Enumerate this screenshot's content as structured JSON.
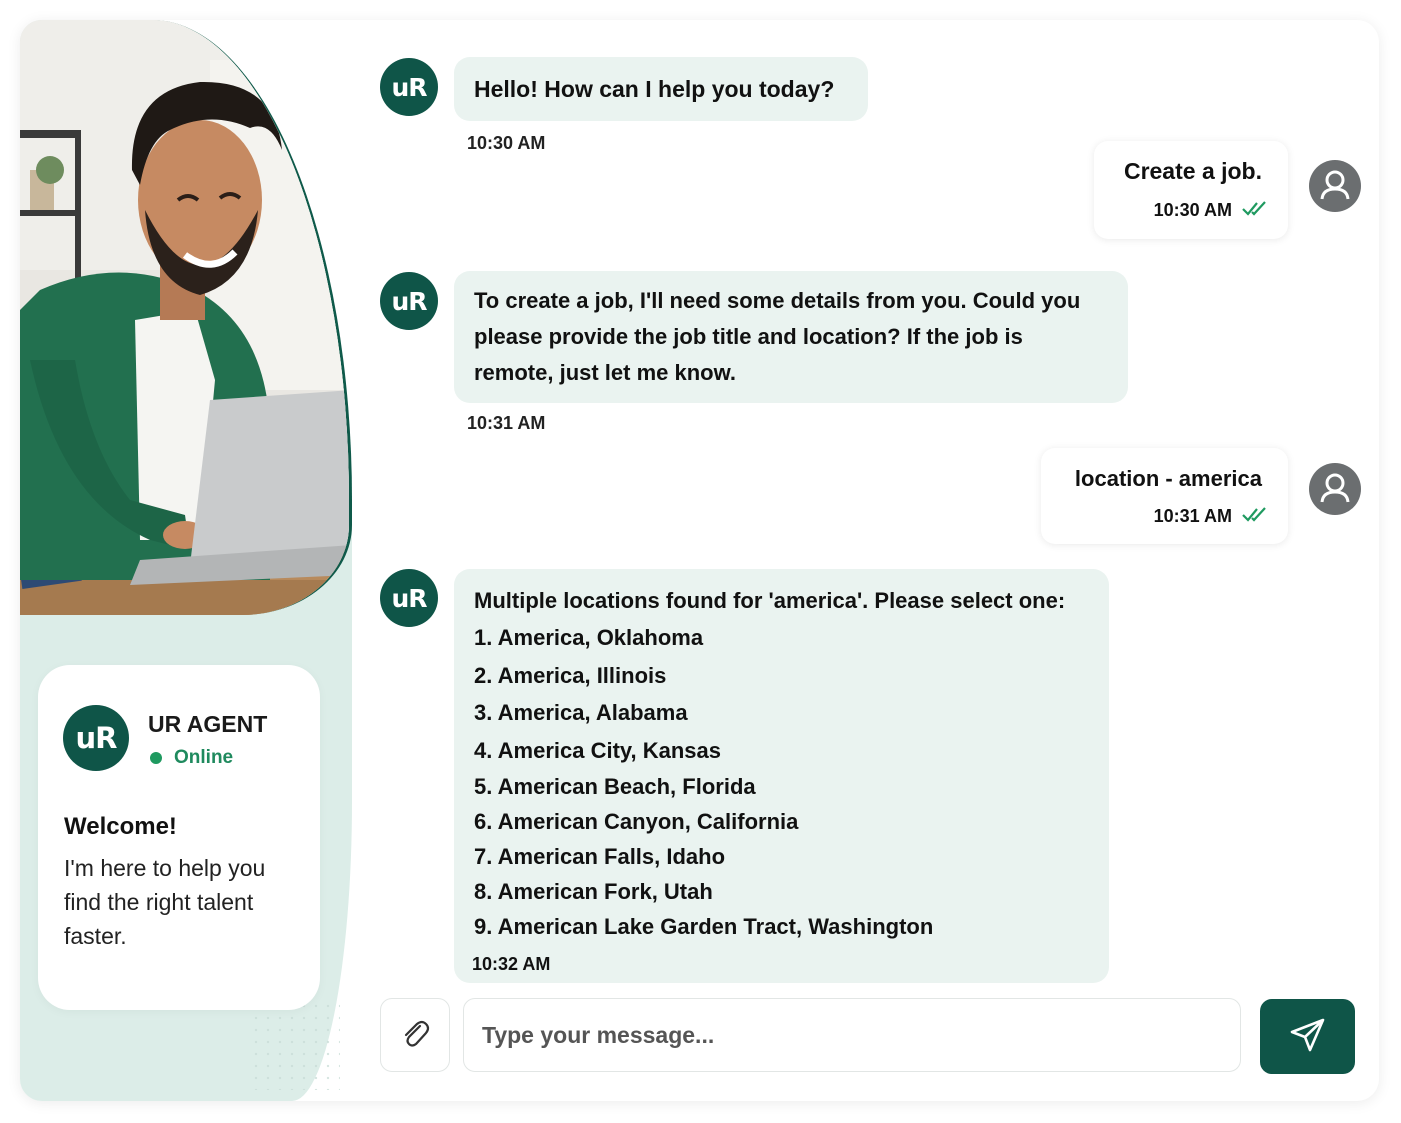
{
  "agent": {
    "name": "UR AGENT",
    "status": "Online",
    "logo_text": "uR",
    "welcome_title": "Welcome!",
    "welcome_text": "I'm here to help you find the right talent faster."
  },
  "messages": [
    {
      "from": "bot",
      "text": "Hello! How can I help you today?",
      "time": "10:30 AM"
    },
    {
      "from": "user",
      "text": "Create a job.",
      "time": "10:30 AM",
      "read": true
    },
    {
      "from": "bot",
      "text_lines": [
        "To create a job, I'll need some details from you. Could you",
        "please provide the job title and location? If the job is",
        "remote, just let me know."
      ],
      "time": "10:31 AM"
    },
    {
      "from": "user",
      "text": "location - america",
      "time": "10:31 AM",
      "read": true
    },
    {
      "from": "bot",
      "intro": "Multiple locations found for 'america'. Please select one:",
      "options": [
        "1.  America, Oklahoma",
        "2.  America, Illinois",
        "3.  America, Alabama",
        "4.  America City, Kansas",
        "5.  American Beach, Florida",
        "6.  American Canyon, California",
        "7.  American Falls, Idaho",
        "8.  American Fork, Utah",
        "9.  American Lake Garden Tract, Washington"
      ],
      "time": "10:32 AM"
    }
  ],
  "composer": {
    "placeholder": "Type your message..."
  },
  "colors": {
    "brand": "#0f5548",
    "online": "#1f9a60",
    "bot_bubble": "#eaf3f0",
    "panel": "#dcede8"
  },
  "icons": {
    "attach": "paperclip-icon",
    "send": "send-icon",
    "read": "double-check-icon",
    "user": "user-avatar-icon"
  }
}
